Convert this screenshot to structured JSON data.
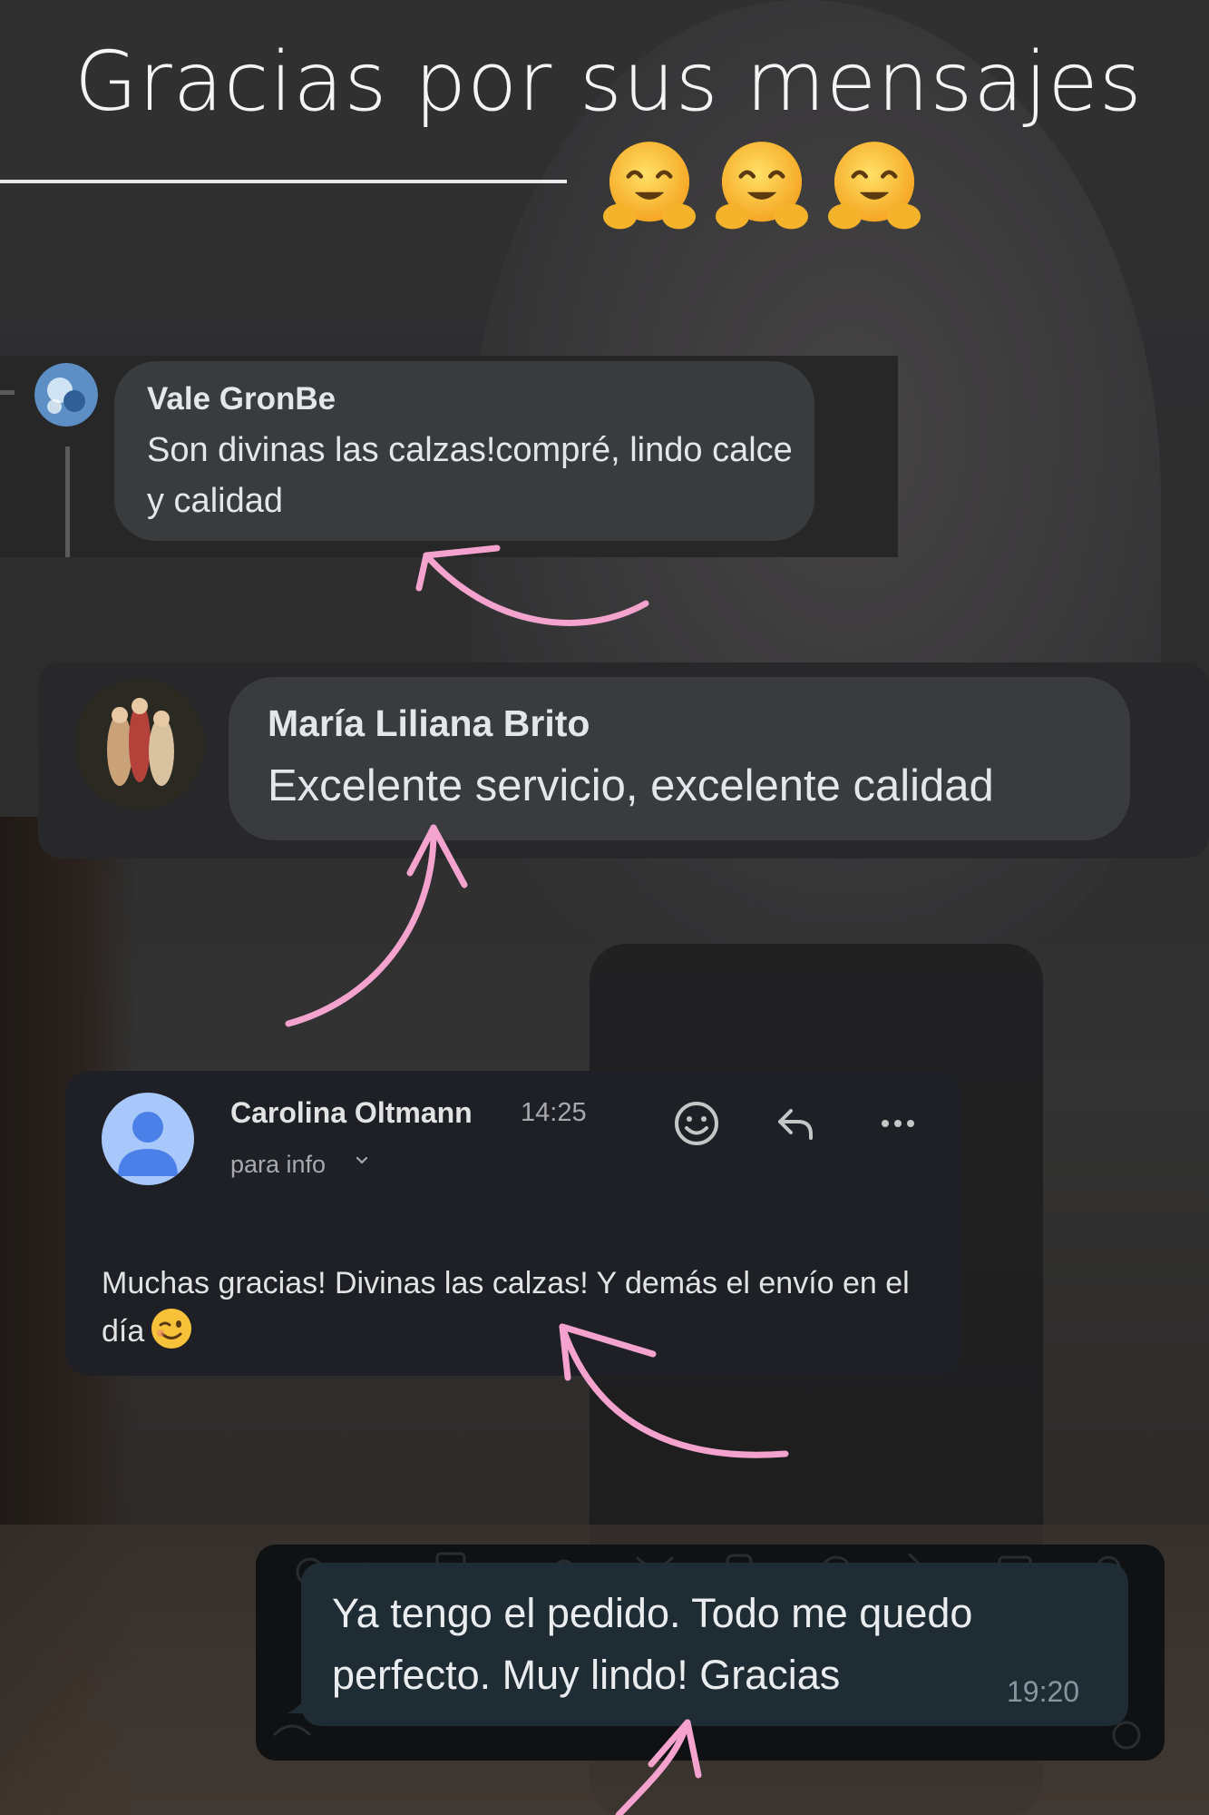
{
  "header": {
    "title": "Gracias por sus mensajes",
    "emoji": [
      "hugging-face",
      "hugging-face",
      "hugging-face"
    ]
  },
  "comments": [
    {
      "author": "Vale GronBe",
      "text": "Son divinas las calzas!compré, lindo calce y calidad"
    },
    {
      "author": "María Liliana Brito",
      "text": "Excelente servicio, excelente calidad"
    }
  ],
  "email": {
    "sender": "Carolina Oltmann",
    "time": "14:25",
    "recipient": "para info",
    "body": "Muchas gracias! Divinas las calzas! Y demás el envío en el día",
    "body_emoji": "winking-face",
    "actions": [
      "emoji-react-icon",
      "reply-icon",
      "more-icon"
    ]
  },
  "chat_message": {
    "text": "Ya tengo el pedido. Todo me quedo perfecto. Muy lindo! Gracias",
    "time": "19:20"
  },
  "colors": {
    "accent_arrow": "#f4a3cf",
    "bubble_dark": "#3a3b3c",
    "email_bg": "#1f2025",
    "whatsapp_bubble": "#202c33",
    "avatar_blue": "#a8c7fa"
  }
}
